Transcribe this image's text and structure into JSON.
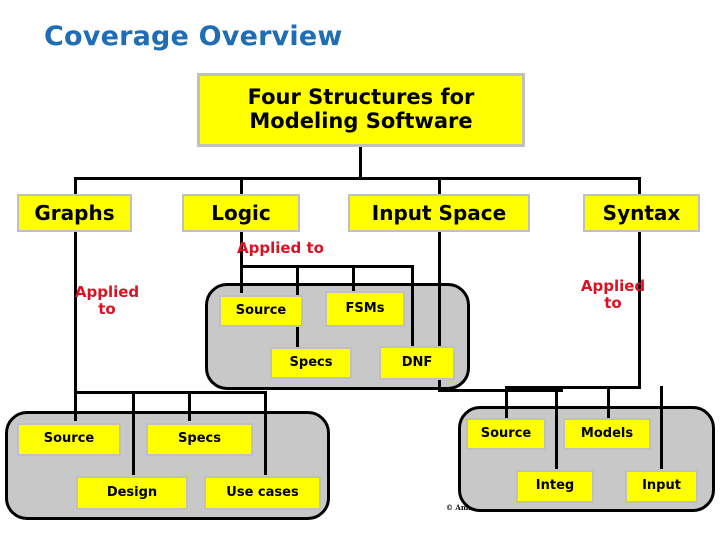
{
  "slide": {
    "title": "Coverage Overview",
    "title_color": "#1f6eb5",
    "background_color": "#ffffff",
    "copyright": "© Ammann & Offutt"
  },
  "colors": {
    "node_fill": "#ffff00",
    "node_border": "#c0c0c0",
    "group_fill": "#c8c8c8",
    "group_border": "#000000",
    "connector": "#000000",
    "annotation": "#dd1122"
  },
  "root": {
    "label": "Four Structures for\nModeling Software",
    "line1": "Four Structures for",
    "line2": "Modeling Software"
  },
  "structures": [
    {
      "id": "graphs",
      "label": "Graphs"
    },
    {
      "id": "logic",
      "label": "Logic"
    },
    {
      "id": "input-space",
      "label": "Input Space"
    },
    {
      "id": "syntax",
      "label": "Syntax"
    }
  ],
  "annotations": [
    {
      "id": "graphs-applied-to",
      "text": "Applied\nto",
      "line1": "Applied",
      "line2": "to"
    },
    {
      "id": "logic-applied-to",
      "text": "Applied to"
    },
    {
      "id": "syntax-applied-to",
      "text": "Applied\nto",
      "line1": "Applied",
      "line2": "to"
    }
  ],
  "groups": [
    {
      "id": "logic-artifacts",
      "parent": "logic",
      "items": [
        {
          "id": "logic-source",
          "label": "Source"
        },
        {
          "id": "logic-fsms",
          "label": "FSMs"
        },
        {
          "id": "logic-specs",
          "label": "Specs"
        },
        {
          "id": "logic-dnf",
          "label": "DNF"
        }
      ]
    },
    {
      "id": "graphs-artifacts",
      "parent": "graphs",
      "items": [
        {
          "id": "graphs-source",
          "label": "Source"
        },
        {
          "id": "graphs-specs",
          "label": "Specs"
        },
        {
          "id": "graphs-design",
          "label": "Design"
        },
        {
          "id": "graphs-use-cases",
          "label": "Use cases"
        }
      ]
    },
    {
      "id": "syntax-artifacts",
      "parent": "syntax",
      "items": [
        {
          "id": "syntax-source",
          "label": "Source"
        },
        {
          "id": "syntax-models",
          "label": "Models"
        },
        {
          "id": "syntax-integ",
          "label": "Integ"
        },
        {
          "id": "syntax-input",
          "label": "Input"
        }
      ]
    }
  ]
}
